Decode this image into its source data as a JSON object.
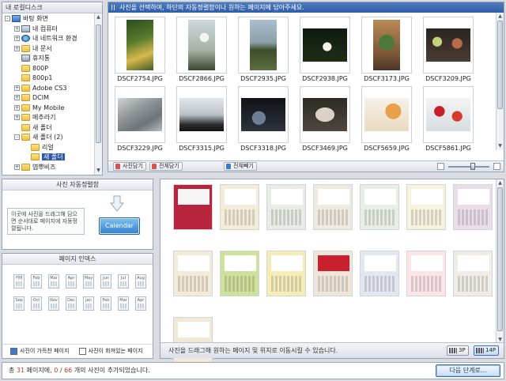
{
  "tree": {
    "title": "내 로컬디스크",
    "items": [
      {
        "label": "바탕 화면",
        "icon": "desktop-icon",
        "toggle": "-",
        "indent": 0
      },
      {
        "label": "내 컴퓨터",
        "icon": "computer-icon",
        "toggle": "+",
        "indent": 1
      },
      {
        "label": "내 네트워크 환경",
        "icon": "network-icon",
        "toggle": "+",
        "indent": 1
      },
      {
        "label": "내 문서",
        "icon": "folder-icon",
        "toggle": "+",
        "indent": 1
      },
      {
        "label": "휴지통",
        "icon": "trash-icon",
        "toggle": "",
        "indent": 1
      },
      {
        "label": "800P",
        "icon": "folder-icon",
        "toggle": "",
        "indent": 1
      },
      {
        "label": "800p1",
        "icon": "folder-icon",
        "toggle": "",
        "indent": 1
      },
      {
        "label": "Adobe CS3",
        "icon": "folder-icon",
        "toggle": "+",
        "indent": 1
      },
      {
        "label": "DCIM",
        "icon": "folder-icon",
        "toggle": "+",
        "indent": 1
      },
      {
        "label": "My Mobile",
        "icon": "folder-icon",
        "toggle": "+",
        "indent": 1
      },
      {
        "label": "메추라기",
        "icon": "folder-icon",
        "toggle": "+",
        "indent": 1
      },
      {
        "label": "새 폴더",
        "icon": "folder-icon",
        "toggle": "",
        "indent": 1
      },
      {
        "label": "새 폴더 (2)",
        "icon": "folder-icon",
        "toggle": "-",
        "indent": 1
      },
      {
        "label": "리얼",
        "icon": "folder-icon",
        "toggle": "",
        "indent": 2
      },
      {
        "label": "새 폴더",
        "icon": "folder-icon",
        "toggle": "",
        "indent": 2,
        "selected": true
      },
      {
        "label": "염뿌비즈",
        "icon": "folder-icon",
        "toggle": "+",
        "indent": 1
      }
    ]
  },
  "photos": {
    "hint": "사진을 선택하여, 하단의 자동정렬함이나 원하는 페이지에 담아주세요.",
    "items": [
      {
        "name": "DSCF2754.JPG",
        "bg": "linear-gradient(160deg,#2b4d1c 0%,#567a2d 40%,#d9b84a 70%,#3f5c28 100%)",
        "orient": "portrait"
      },
      {
        "name": "DSCF2866.JPG",
        "bg": "radial-gradient(circle at 60% 35%,#f4f4f2 0 12%,transparent 13%),linear-gradient(#cfd8e0,#a8b2a6 60%,#3b4a2e)",
        "orient": "portrait"
      },
      {
        "name": "DSCF2935.JPG",
        "bg": "linear-gradient(#a8bfcf 0%,#8da0a8 45%,#3b4d2a 60%,#5d7040 100%)",
        "orient": "portrait"
      },
      {
        "name": "DSCF2938.JPG",
        "bg": "radial-gradient(circle at 55% 55%,#f4f4ee 0 14%,transparent 15%),linear-gradient(#0f1a10,#1e2e16)",
        "orient": "landscape"
      },
      {
        "name": "DSCF3173.JPG",
        "bg": "radial-gradient(circle at 50% 45%,#4c7a36 0 25%,transparent 26%),linear-gradient(#b98a58,#7a5636 70%,#4a3526)",
        "orient": "portrait"
      },
      {
        "name": "DSCF3209.JPG",
        "bg": "radial-gradient(circle at 25% 40%,#c3d27a 0 12%,transparent 13%),radial-gradient(circle at 70% 45%,#b86b4a 0 14%,transparent 15%),linear-gradient(#2a2420,#4a3c32)",
        "orient": "landscape"
      },
      {
        "name": "DSCF3229.JPG",
        "bg": "linear-gradient(150deg,#cfd3d6 0%,#8f9598 40%,#6c7478 70%,#b7bcbf 100%)",
        "orient": "landscape"
      },
      {
        "name": "DSCF3315.JPG",
        "bg": "linear-gradient(#e2e6ea,#b9c1c8 50%,#2a2c2e 80%,#111)",
        "orient": "landscape"
      },
      {
        "name": "DSCF3318.JPG",
        "bg": "radial-gradient(circle at 40% 60%,#6d7f95 0 20%,transparent 21%),linear-gradient(#101216,#2d343e)",
        "orient": "landscape"
      },
      {
        "name": "DSCF3469.JPG",
        "bg": "radial-gradient(ellipse at 50% 50%,#d9d2c4 0 30%,transparent 31%),linear-gradient(#2c2924,#4e4840)",
        "orient": "landscape"
      },
      {
        "name": "DSCF5659.JPG",
        "bg": "radial-gradient(circle at 65% 40%,#e8a04a 0 22%,transparent 23%),linear-gradient(#f6f1e6,#e9dac2)",
        "orient": "landscape"
      },
      {
        "name": "DSCF5861.JPG",
        "bg": "radial-gradient(circle at 30% 40%,#c8202a 0 14%,transparent 15%),radial-gradient(circle at 70% 55%,#d63a2e 0 14%,transparent 15%),linear-gradient(#f3f3f3,#d9dde0)",
        "orient": "landscape"
      }
    ],
    "toolbar": {
      "load_label": "사진담기",
      "load_all_label": "전체담기",
      "remove_all_label": "전체빼기"
    }
  },
  "auto_panel": {
    "title": "사진 자동정렬함",
    "description": "이곳에 사진을 드래그해 담으면 순서대로 페이지에 자동정렬됩니다.",
    "button_label": "Calendar"
  },
  "index_panel": {
    "title": "페이지 인덱스",
    "row1": [
      "커버",
      "Feb",
      "Mar",
      "Apr",
      "May",
      "Jun",
      "Jul",
      "Aug"
    ],
    "row2": [
      "Sep",
      "Oct",
      "Nov",
      "Dec",
      "Jan",
      "Feb",
      "Mar",
      "Apr"
    ],
    "legend_full": "사진이 가득찬 페이지",
    "legend_empty": "사진이 화져있는 페이지",
    "legend_full_color": "#3a7ad0",
    "legend_empty_color": "#ffffff"
  },
  "templates": {
    "items": [
      {
        "bg": "#b8253a",
        "photo": "#f5f5f5",
        "grid": "transparent"
      },
      {
        "bg": "#f4ecd8",
        "photo": "#ffffff",
        "grid": "#bba"
      },
      {
        "bg": "#e8ece4",
        "photo": "#ffffff",
        "grid": "#9bb"
      },
      {
        "bg": "#efe9df",
        "photo": "#ffffff",
        "grid": "#a98"
      },
      {
        "bg": "#e7efe5",
        "photo": "#ffffff",
        "grid": "#8a9"
      },
      {
        "bg": "#f7f2dc",
        "photo": "#ffffff",
        "grid": "#b9a"
      },
      {
        "bg": "#e9dde9",
        "photo": "#ffffff",
        "grid": "#a8a"
      },
      {
        "bg": "#f3ead7",
        "photo": "#ffffff",
        "grid": "#a98"
      },
      {
        "bg": "#cfe09a",
        "photo": "#ffffff",
        "grid": "#795"
      },
      {
        "bg": "#f5ecb8",
        "photo": "#ffffff",
        "grid": "#b94"
      },
      {
        "bg": "#efe6da",
        "photo": "#c8202e",
        "grid": "#a98"
      },
      {
        "bg": "#e4e6f2",
        "photo": "#ffffff",
        "grid": "#99a"
      },
      {
        "bg": "#fce4e8",
        "photo": "#ffffff",
        "grid": "#c99"
      },
      {
        "bg": "#f0ece6",
        "photo": "#ffffff",
        "grid": "#aaa"
      },
      {
        "bg": "#f1e8d6",
        "photo": "#ffffff",
        "grid": "#a98"
      }
    ],
    "footer_hint": "사진을 드래그해 원하는 페이지 및 위치로 이동시킬 수 있습니다.",
    "view_3p": "3P",
    "view_14p": "14P"
  },
  "status": {
    "prefix": "총",
    "photo_count": "31",
    "middle": "페이지에,",
    "added": "0",
    "separator": "/",
    "total": "66",
    "suffix": "개의 사진이 추가되었습니다.",
    "next_button": "다음 단계로..."
  }
}
